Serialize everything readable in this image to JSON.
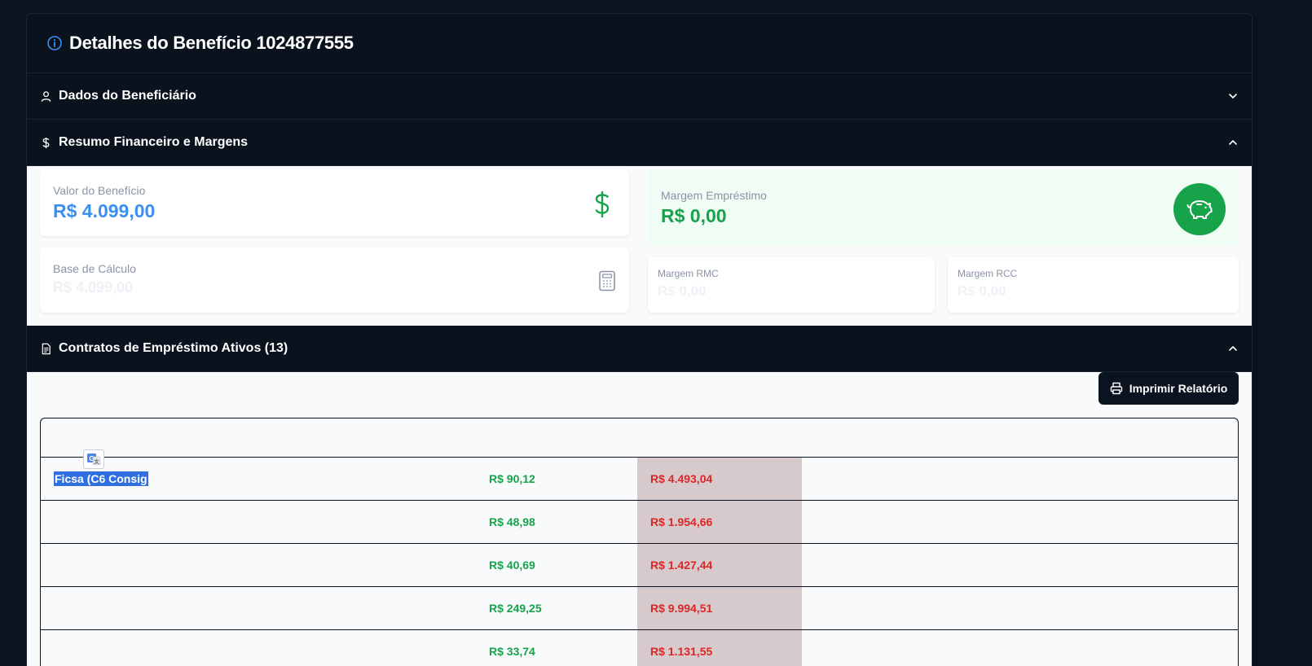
{
  "header": {
    "title": "Detalhes do Benefício 1024877555"
  },
  "sections": {
    "beneficiario": {
      "title": "Dados do Beneficiário",
      "expanded": false
    },
    "financeiro": {
      "title": "Resumo Financeiro e Margens",
      "expanded": true
    },
    "contratos": {
      "title": "Contratos de Empréstimo Ativos (13)",
      "expanded": true
    }
  },
  "financeiro": {
    "valor_beneficio": {
      "label": "Valor do Benefício",
      "value": "R$ 4.099,00"
    },
    "base_calculo": {
      "label": "Base de Cálculo",
      "value": "R$ 4.099,00"
    },
    "margem_emprestimo": {
      "label": "Margem Empréstimo",
      "value": "R$ 0,00"
    },
    "margem_rmc": {
      "label": "Margem RMC",
      "value": "R$ 0,00"
    },
    "margem_rcc": {
      "label": "Margem RCC",
      "value": "R$ 0,00"
    }
  },
  "contratos": {
    "print_label": "Imprimir Relatório",
    "rows": [
      {
        "banco": "Ficsa (C6 Consig",
        "parcela": "R$ 90,12",
        "saldo": "R$ 4.493,04"
      },
      {
        "banco": "",
        "parcela": "R$ 48,98",
        "saldo": "R$ 1.954,66"
      },
      {
        "banco": "",
        "parcela": "R$ 40,69",
        "saldo": "R$ 1.427,44"
      },
      {
        "banco": "",
        "parcela": "R$ 249,25",
        "saldo": "R$ 9.994,51"
      },
      {
        "banco": "",
        "parcela": "R$ 33,74",
        "saldo": "R$ 1.131,55"
      }
    ]
  },
  "colors": {
    "accent_blue": "#3b8ff0",
    "positive_green": "#16a34a",
    "negative_red": "#dc2626",
    "dark_bg": "#0b1220"
  },
  "icons": {
    "header": "info-icon",
    "beneficiario": "user-icon",
    "financeiro": "dollar-icon",
    "contratos": "document-icon",
    "valor": "dollar-sign-icon",
    "base": "calculator-icon",
    "margem": "piggy-bank-icon",
    "print": "printer-icon",
    "translate": "google-translate-icon"
  }
}
